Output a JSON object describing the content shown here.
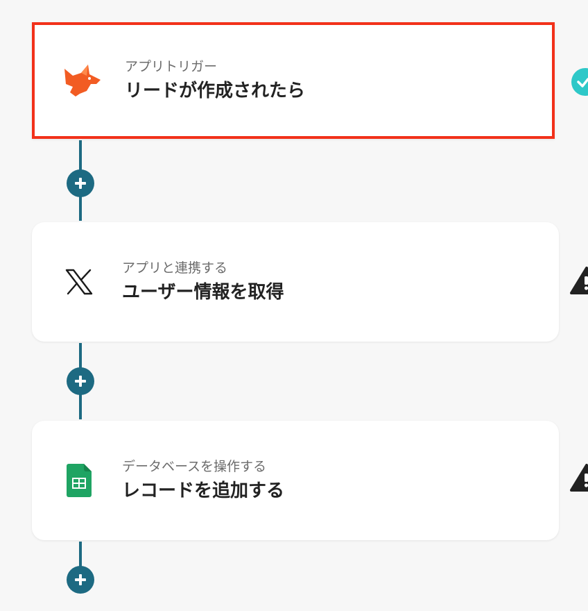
{
  "colors": {
    "connector": "#1d6a82",
    "selected_border": "#f2311a",
    "success": "#2ec8c8",
    "warning": "#222222"
  },
  "steps": [
    {
      "subtitle": "アプリトリガー",
      "title": "リードが作成されたら",
      "icon": "fox-logo-icon",
      "status": "success-check-icon",
      "selected": true
    },
    {
      "subtitle": "アプリと連携する",
      "title": "ユーザー情報を取得",
      "icon": "x-logo-icon",
      "status": "warning-icon",
      "selected": false
    },
    {
      "subtitle": "データベースを操作する",
      "title": "レコードを追加する",
      "icon": "google-sheets-icon",
      "status": "warning-icon",
      "selected": false
    }
  ],
  "add_buttons": [
    {
      "icon": "plus-icon"
    },
    {
      "icon": "plus-icon"
    },
    {
      "icon": "plus-icon"
    }
  ]
}
